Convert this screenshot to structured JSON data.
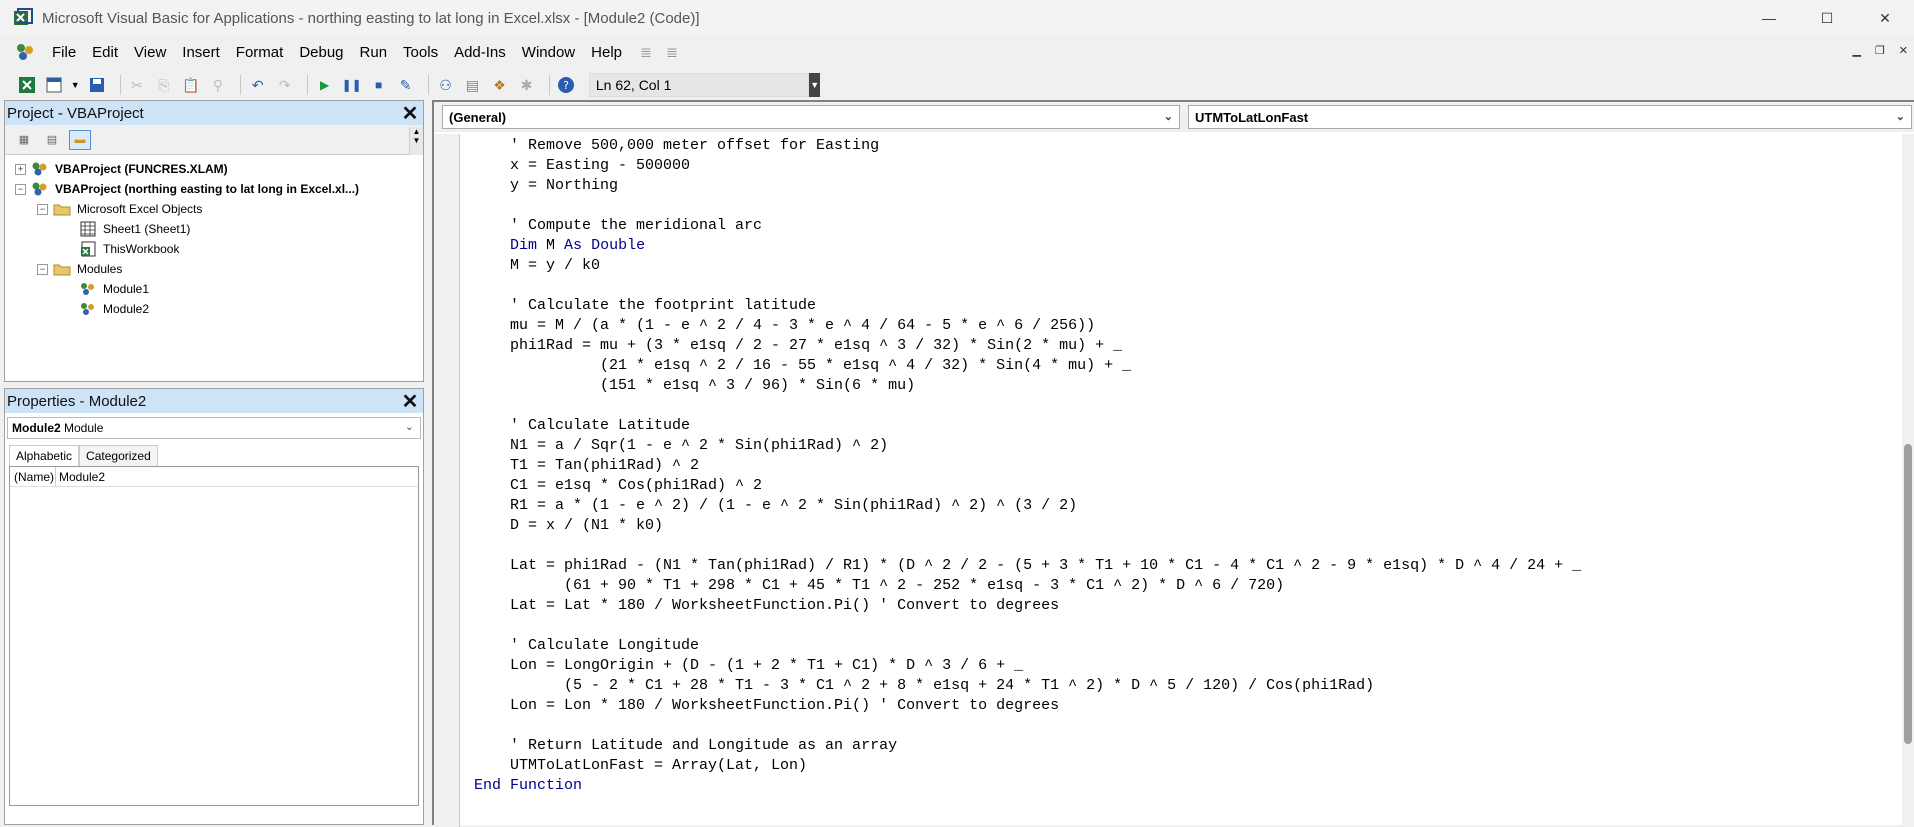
{
  "window": {
    "title": "Microsoft Visual Basic for Applications - northing easting to lat long in Excel.xlsx - [Module2 (Code)]",
    "minimize": "—",
    "maximize": "☐",
    "close": "✕"
  },
  "menu": {
    "items": [
      "File",
      "Edit",
      "View",
      "Insert",
      "Format",
      "Debug",
      "Run",
      "Tools",
      "Add-Ins",
      "Window",
      "Help"
    ]
  },
  "toolbar": {
    "position_text": "Ln 62, Col 1"
  },
  "project_panel": {
    "title": "Project - VBAProject",
    "tree": [
      {
        "label": "VBAProject (FUNCRES.XLAM)",
        "bold": true,
        "level": 0,
        "expander": "+"
      },
      {
        "label": "VBAProject (northing easting to lat long in Excel.xl...)",
        "bold": true,
        "level": 0,
        "expander": "−"
      },
      {
        "label": "Microsoft Excel Objects",
        "level": 1,
        "expander": "−"
      },
      {
        "label": "Sheet1 (Sheet1)",
        "level": 2
      },
      {
        "label": "ThisWorkbook",
        "level": 2
      },
      {
        "label": "Modules",
        "level": 1,
        "expander": "−"
      },
      {
        "label": "Module1",
        "level": 2
      },
      {
        "label": "Module2",
        "level": 2
      }
    ]
  },
  "properties_panel": {
    "title": "Properties - Module2",
    "object_name": "Module2",
    "object_type": "Module",
    "tabs": [
      "Alphabetic",
      "Categorized"
    ],
    "rows": [
      {
        "name": "(Name)",
        "value": "Module2"
      }
    ]
  },
  "code_window": {
    "object_select": "(General)",
    "procedure_select": "UTMToLatLonFast",
    "lines": [
      "    ' Remove 500,000 meter offset for Easting",
      "    x = Easting - 500000",
      "    y = Northing",
      "",
      "    ' Compute the meridional arc",
      "    Dim M As Double",
      "    M = y / k0",
      "",
      "    ' Calculate the footprint latitude",
      "    mu = M / (a * (1 - e ^ 2 / 4 - 3 * e ^ 4 / 64 - 5 * e ^ 6 / 256))",
      "    phi1Rad = mu + (3 * e1sq / 2 - 27 * e1sq ^ 3 / 32) * Sin(2 * mu) + _",
      "              (21 * e1sq ^ 2 / 16 - 55 * e1sq ^ 4 / 32) * Sin(4 * mu) + _",
      "              (151 * e1sq ^ 3 / 96) * Sin(6 * mu)",
      "",
      "    ' Calculate Latitude",
      "    N1 = a / Sqr(1 - e ^ 2 * Sin(phi1Rad) ^ 2)",
      "    T1 = Tan(phi1Rad) ^ 2",
      "    C1 = e1sq * Cos(phi1Rad) ^ 2",
      "    R1 = a * (1 - e ^ 2) / (1 - e ^ 2 * Sin(phi1Rad) ^ 2) ^ (3 / 2)",
      "    D = x / (N1 * k0)",
      "",
      "    Lat = phi1Rad - (N1 * Tan(phi1Rad) / R1) * (D ^ 2 / 2 - (5 + 3 * T1 + 10 * C1 - 4 * C1 ^ 2 - 9 * e1sq) * D ^ 4 / 24 + _",
      "          (61 + 90 * T1 + 298 * C1 + 45 * T1 ^ 2 - 252 * e1sq - 3 * C1 ^ 2) * D ^ 6 / 720)",
      "    Lat = Lat * 180 / WorksheetFunction.Pi() ' Convert to degrees",
      "",
      "    ' Calculate Longitude",
      "    Lon = LongOrigin + (D - (1 + 2 * T1 + C1) * D ^ 3 / 6 + _",
      "          (5 - 2 * C1 + 28 * T1 - 3 * C1 ^ 2 + 8 * e1sq + 24 * T1 ^ 2) * D ^ 5 / 120) / Cos(phi1Rad)",
      "    Lon = Lon * 180 / WorksheetFunction.Pi() ' Convert to degrees",
      "",
      "    ' Return Latitude and Longitude as an array",
      "    UTMToLatLonFast = Array(Lat, Lon)",
      "End Function"
    ]
  }
}
